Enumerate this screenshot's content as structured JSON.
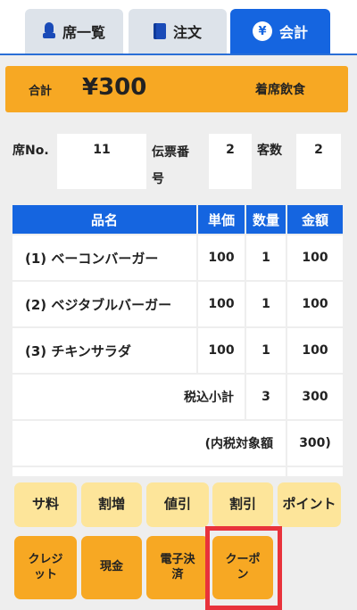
{
  "tabs": [
    {
      "label": "席一覧",
      "icon": "seat-icon"
    },
    {
      "label": "注文",
      "icon": "book-icon"
    },
    {
      "label": "会計",
      "icon": "yen-icon"
    }
  ],
  "summary": {
    "total_label": "合計",
    "total_amount": "¥300",
    "dine_type": "着席飲食"
  },
  "info": {
    "seat_label": "席No.",
    "seat_value": "11",
    "slip_label_line1": "伝票番",
    "slip_label_line2": "号",
    "slip_value": "2",
    "guests_label": "客数",
    "guests_value": "2"
  },
  "table": {
    "headers": [
      "品名",
      "単価",
      "数量",
      "金額"
    ],
    "rows": [
      {
        "name": "(1) ベーコンバーガー",
        "price": "100",
        "qty": "1",
        "amount": "100"
      },
      {
        "name": "(2) ベジタブルバーガー",
        "price": "100",
        "qty": "1",
        "amount": "100"
      },
      {
        "name": "(3) チキンサラダ",
        "price": "100",
        "qty": "1",
        "amount": "100"
      }
    ],
    "subtotal": {
      "label": "税込小計",
      "qty": "3",
      "amount": "300"
    },
    "tax_target": {
      "label": "(内税対象額",
      "amount": "300)"
    }
  },
  "buttons_row1": [
    "サ料",
    "割増",
    "値引",
    "割引",
    "ポイント"
  ],
  "buttons_row2": [
    {
      "line1": "クレジ",
      "line2": "ット"
    },
    {
      "line1": "現金",
      "line2": ""
    },
    {
      "line1": "電子決",
      "line2": "済"
    },
    {
      "line1": "クーポ",
      "line2": "ン"
    }
  ],
  "colors": {
    "accent_blue": "#1565e0",
    "orange": "#f7a823",
    "light_yellow": "#fde59a",
    "highlight_red": "#e8323b"
  }
}
